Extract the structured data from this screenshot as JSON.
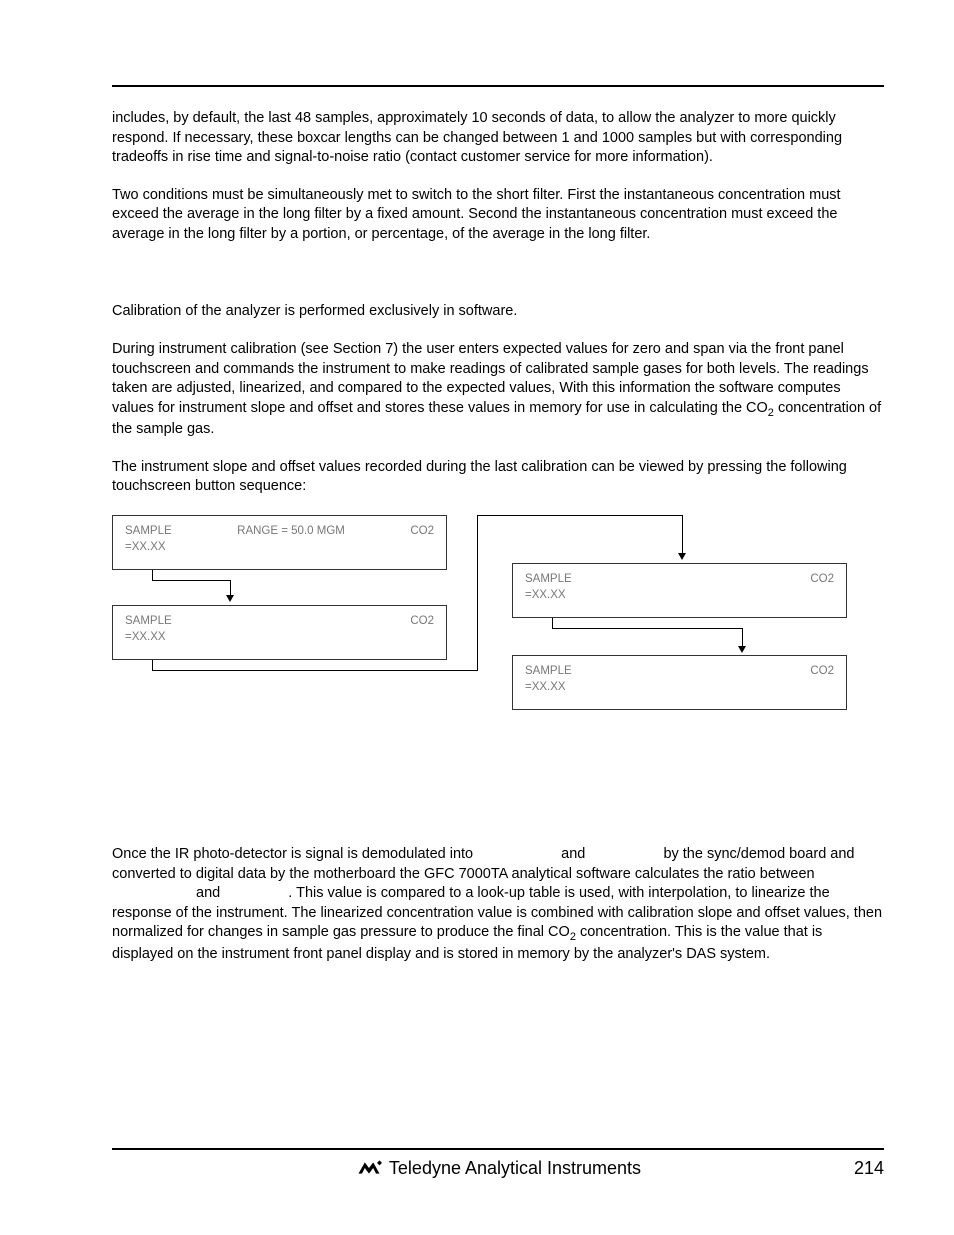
{
  "paragraphs": {
    "p1": "includes, by default, the last 48 samples, approximately 10 seconds of data, to allow the analyzer to more quickly respond.  If necessary, these boxcar lengths can be changed between 1 and 1000 samples but with corresponding tradeoffs in rise time and signal-to-noise ratio (contact customer service for more information).",
    "p2": "Two conditions must be simultaneously met to switch to the short filter.  First the instantaneous concentration must exceed the average in the long filter by a fixed amount.  Second the instantaneous concentration must exceed the average in the long filter by a portion, or percentage, of the average in the long filter.",
    "p3": "Calibration of the analyzer is performed exclusively in software.",
    "p4_a": "During instrument calibration (see Section 7) the user enters expected values for zero and span via the front panel touchscreen and commands the instrument to make readings of calibrated sample gases for both levels.  The readings taken are adjusted, linearized, and compared to the expected values, With this information the software computes values for instrument slope and offset and stores these values in memory for use in calculating the CO",
    "p4_b": " concentration of the sample gas.",
    "p5": "The instrument slope and offset values recorded during the last calibration can be viewed by pressing the following touchscreen button sequence:",
    "p6_a": "Once the IR photo-detector is signal is demodulated into ",
    "p6_b": " and ",
    "p6_c": " by the sync/demod board and converted to digital data by the motherboard the GFC 7000TA analytical software calculates the ratio between ",
    "p6_d": " and ",
    "p6_e": ".  This value is compared to a look-up table is used, with interpolation, to linearize the response of the instrument.  The linearized concentration value is combined with calibration slope and offset values, then normalized for changes in sample gas pressure to produce the final CO",
    "p6_f": " concentration.  This is the value that is displayed on the instrument front panel display and is stored in memory by the analyzer's DAS system."
  },
  "subscript": "2",
  "diagram": {
    "sample_line1": "SAMPLE",
    "sample_line2": "=XX.XX",
    "range": "RANGE = 50.0 MGM",
    "co2": "CO2"
  },
  "footer": {
    "company": "Teledyne Analytical Instruments",
    "page": "214"
  }
}
